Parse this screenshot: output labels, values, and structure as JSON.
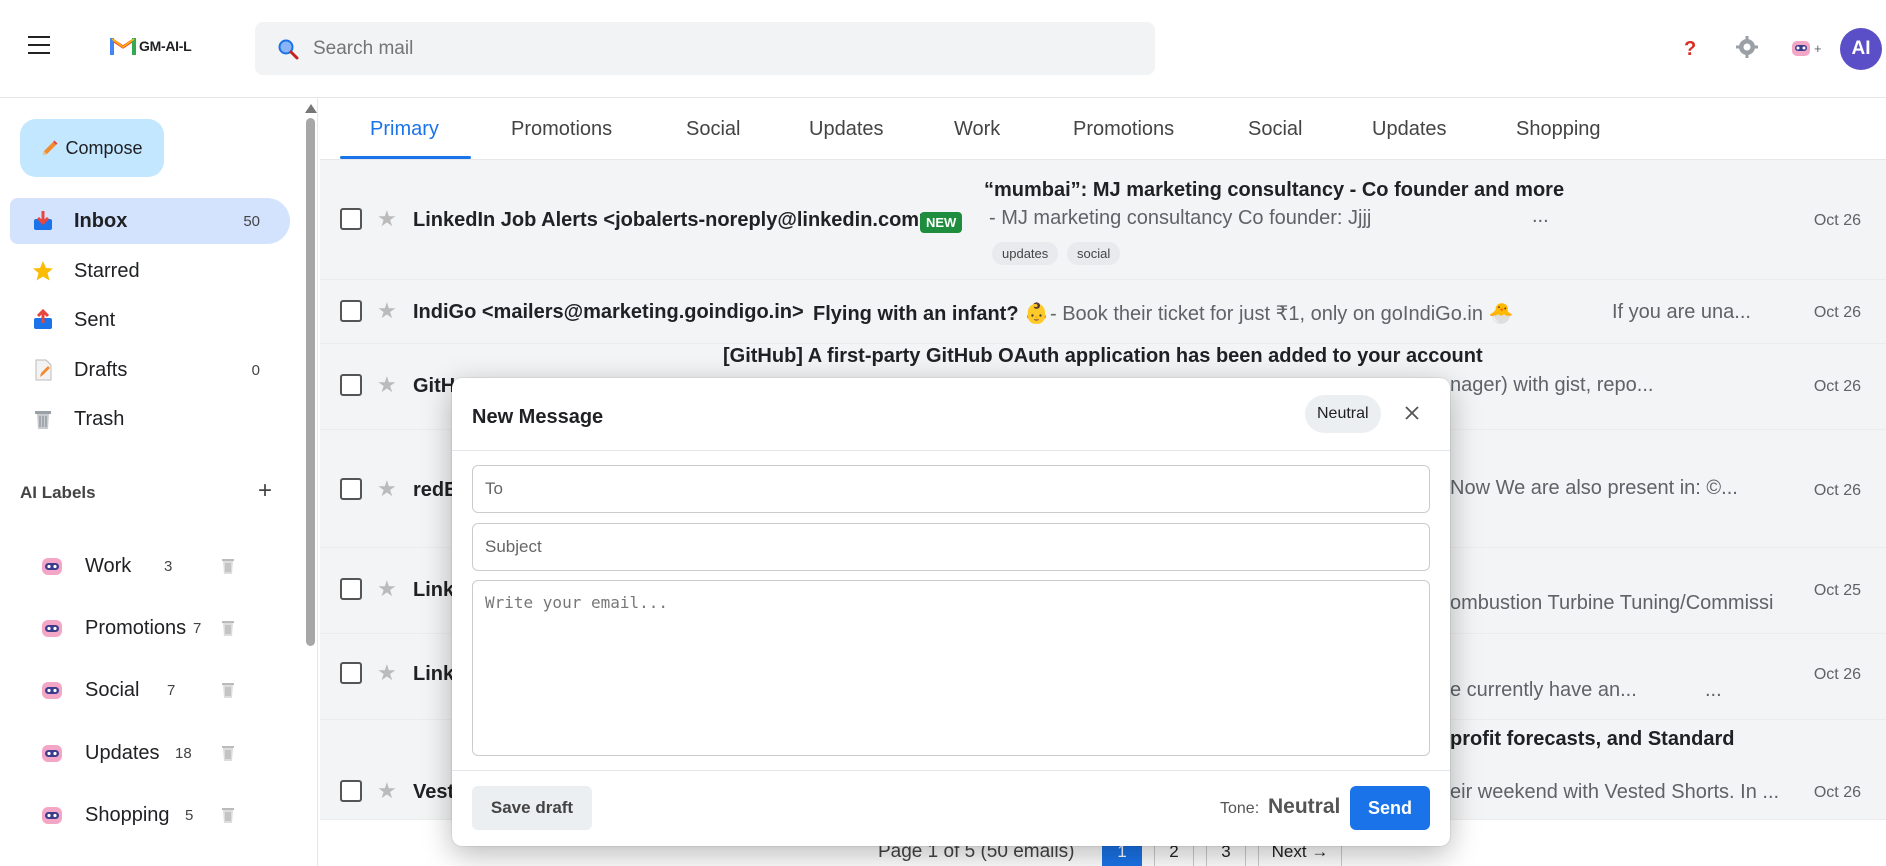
{
  "header": {
    "logo_text": "GM-AI-L",
    "search_placeholder": "Search mail",
    "help_glyph": "?",
    "avatar_initials": "AI",
    "bot_plus": "+"
  },
  "sidebar": {
    "compose_label": "Compose",
    "items": [
      {
        "label": "Inbox",
        "count": "50",
        "icon": "inbox-icon"
      },
      {
        "label": "Starred",
        "count": "",
        "icon": "star-icon"
      },
      {
        "label": "Sent",
        "count": "",
        "icon": "sent-icon"
      },
      {
        "label": "Drafts",
        "count": "0",
        "icon": "drafts-icon"
      },
      {
        "label": "Trash",
        "count": "",
        "icon": "trash-icon"
      }
    ],
    "ai_labels_heading": "AI Labels",
    "ai_add": "+",
    "ai_labels": [
      {
        "label": "Work",
        "count": "3"
      },
      {
        "label": "Promotions",
        "count": "7"
      },
      {
        "label": "Social",
        "count": "7"
      },
      {
        "label": "Updates",
        "count": "18"
      },
      {
        "label": "Shopping",
        "count": "5"
      }
    ]
  },
  "tabs": [
    "Primary",
    "Promotions",
    "Social",
    "Updates",
    "Work",
    "Promotions",
    "Social",
    "Updates",
    "Shopping"
  ],
  "emails": [
    {
      "sender": "LinkedIn Job Alerts <jobalerts-noreply@linkedin.com>",
      "badge": "NEW",
      "subject": "“mumbai”: MJ marketing consultancy - Co founder and more",
      "snippet": "- MJ marketing consultancy Co founder: Jjjj",
      "ellipsis": "...",
      "tags": [
        "updates",
        "social"
      ],
      "date": "Oct 26"
    },
    {
      "sender": "IndiGo <mailers@marketing.goindigo.in>",
      "subject": "Flying with an infant? 👶",
      "snippet": "- Book their ticket for just ₹1, only on goIndiGo.in 🐣",
      "snippet2": "If you are una...",
      "date": "Oct 26"
    },
    {
      "sender": "GitH",
      "subject": "[GitHub] A first-party GitHub OAuth application has been added to your account",
      "snippet": "nager) with gist, repo...",
      "date": "Oct 26"
    },
    {
      "sender": "redE",
      "snippet": "Now We are also present in: ©...",
      "date": "Oct 26"
    },
    {
      "sender": "Link",
      "snippet": "ombustion Turbine Tuning/Commissi",
      "date": "Oct 25"
    },
    {
      "sender": "Link",
      "snippet": "e currently have an...",
      "ellipsis": "...",
      "date": "Oct 26"
    },
    {
      "sender": "Vest",
      "subject": "profit forecasts, and Standard",
      "snippet": "eir weekend with Vested Shorts. In ...",
      "date": "Oct 26"
    }
  ],
  "pager": {
    "text": "Page 1 of 5 (50 emails)",
    "pages": [
      "1",
      "2",
      "3"
    ],
    "next": "Next →"
  },
  "compose_modal": {
    "title": "New Message",
    "tone_pill": "Neutral",
    "to_placeholder": "To",
    "subject_placeholder": "Subject",
    "body_placeholder": "Write your email...",
    "save_draft": "Save draft",
    "tone_label": "Tone:",
    "tone_value": "Neutral",
    "send": "Send"
  },
  "colors": {
    "accent": "#1a73e8",
    "compose_bg": "#c2e7ff",
    "active_nav_bg": "#d3e3fd",
    "new_badge": "#1e8e3e",
    "avatar": "#5b4fc7"
  }
}
